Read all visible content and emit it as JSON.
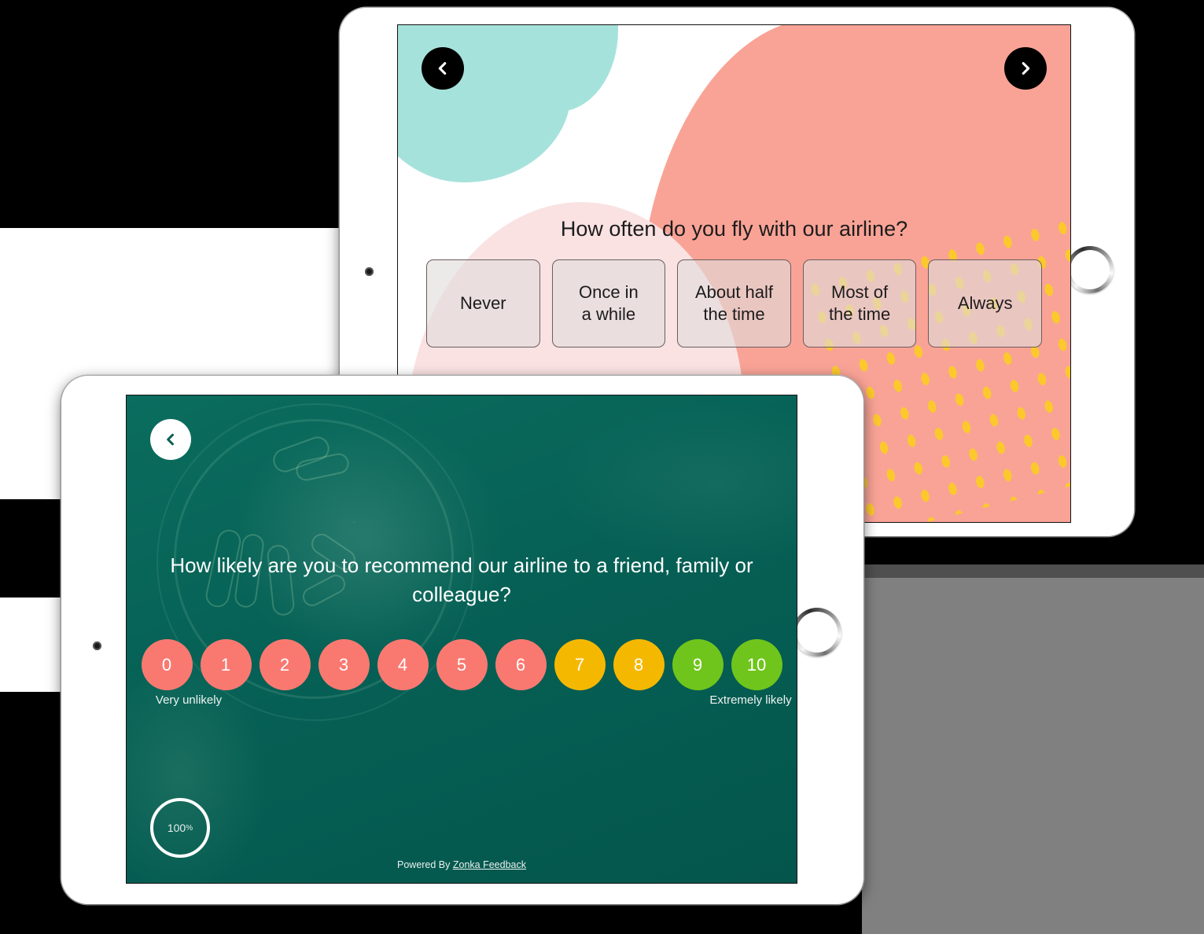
{
  "survey_top": {
    "question": "How often do you fly with our airline?",
    "nav": {
      "prev_icon": "chevron-left-icon",
      "next_icon": "chevron-right-icon"
    },
    "choices": [
      {
        "label": "Never"
      },
      {
        "label": "Once in\na while"
      },
      {
        "label": "About half\nthe time"
      },
      {
        "label": "Most of\nthe time"
      },
      {
        "label": "Always"
      }
    ],
    "theme": {
      "teal": "#A6E2DC",
      "coral": "#F9A396",
      "pink": "#FAE2E2",
      "dot_yellow": "#FBC92C",
      "nav_bg": "#000000",
      "choice_text": "#1C1C1C"
    }
  },
  "survey_bottom": {
    "question": "How likely are you to recommend our airline to a friend, family or colleague?",
    "nav": {
      "prev_icon": "chevron-left-icon"
    },
    "scale": {
      "points": [
        {
          "value": "0",
          "color": "#F97971"
        },
        {
          "value": "1",
          "color": "#F97971"
        },
        {
          "value": "2",
          "color": "#F97971"
        },
        {
          "value": "3",
          "color": "#F97971"
        },
        {
          "value": "4",
          "color": "#F97971"
        },
        {
          "value": "5",
          "color": "#F97971"
        },
        {
          "value": "6",
          "color": "#F97971"
        },
        {
          "value": "7",
          "color": "#F5B800"
        },
        {
          "value": "8",
          "color": "#F5B800"
        },
        {
          "value": "9",
          "color": "#6FC51B"
        },
        {
          "value": "10",
          "color": "#6FC51B"
        }
      ],
      "low_label": "Very unlikely",
      "high_label": "Extremely likely"
    },
    "progress": {
      "value": "100",
      "unit": "%"
    },
    "footer": {
      "prefix": "Powered By ",
      "brand": "Zonka Feedback"
    },
    "theme": {
      "screen_bg": "#066055",
      "text": "#FFFFFF"
    }
  }
}
